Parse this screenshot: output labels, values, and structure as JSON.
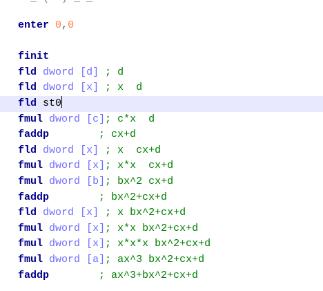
{
  "editor": {
    "top_partial": "  _ (  ) _ _ ",
    "lines": [
      {
        "parts": [
          {
            "t": "kw",
            "v": "enter"
          },
          {
            "t": "sp",
            "v": " "
          },
          {
            "t": "num",
            "v": "0"
          },
          {
            "t": "punct",
            "v": ","
          },
          {
            "t": "num",
            "v": "0"
          }
        ]
      },
      {
        "parts": []
      },
      {
        "parts": [
          {
            "t": "kw",
            "v": "finit"
          }
        ]
      },
      {
        "parts": [
          {
            "t": "kw",
            "v": "fld"
          },
          {
            "t": "sp",
            "v": " "
          },
          {
            "t": "size",
            "v": "dword"
          },
          {
            "t": "sp",
            "v": " "
          },
          {
            "t": "bracket",
            "v": "[d]"
          },
          {
            "t": "sp",
            "v": " "
          },
          {
            "t": "cmt",
            "v": "; d"
          }
        ]
      },
      {
        "parts": [
          {
            "t": "kw",
            "v": "fld"
          },
          {
            "t": "sp",
            "v": " "
          },
          {
            "t": "size",
            "v": "dword"
          },
          {
            "t": "sp",
            "v": " "
          },
          {
            "t": "bracket",
            "v": "[x]"
          },
          {
            "t": "sp",
            "v": " "
          },
          {
            "t": "cmt",
            "v": "; x  d"
          }
        ]
      },
      {
        "current": true,
        "caret": true,
        "parts": [
          {
            "t": "kw",
            "v": "fld"
          },
          {
            "t": "sp",
            "v": " "
          },
          {
            "t": "reg",
            "v": "st0"
          }
        ]
      },
      {
        "parts": [
          {
            "t": "kw",
            "v": "fmul"
          },
          {
            "t": "sp",
            "v": " "
          },
          {
            "t": "size",
            "v": "dword"
          },
          {
            "t": "sp",
            "v": " "
          },
          {
            "t": "bracket",
            "v": "[c]"
          },
          {
            "t": "cmt",
            "v": "; c*x  d"
          }
        ]
      },
      {
        "parts": [
          {
            "t": "kw",
            "v": "faddp"
          },
          {
            "t": "sp",
            "v": "        "
          },
          {
            "t": "cmt",
            "v": "; cx+d"
          }
        ]
      },
      {
        "parts": [
          {
            "t": "kw",
            "v": "fld"
          },
          {
            "t": "sp",
            "v": " "
          },
          {
            "t": "size",
            "v": "dword"
          },
          {
            "t": "sp",
            "v": " "
          },
          {
            "t": "bracket",
            "v": "[x]"
          },
          {
            "t": "sp",
            "v": " "
          },
          {
            "t": "cmt",
            "v": "; x  cx+d"
          }
        ]
      },
      {
        "parts": [
          {
            "t": "kw",
            "v": "fmul"
          },
          {
            "t": "sp",
            "v": " "
          },
          {
            "t": "size",
            "v": "dword"
          },
          {
            "t": "sp",
            "v": " "
          },
          {
            "t": "bracket",
            "v": "[x]"
          },
          {
            "t": "cmt",
            "v": "; x*x  cx+d"
          }
        ]
      },
      {
        "parts": [
          {
            "t": "kw",
            "v": "fmul"
          },
          {
            "t": "sp",
            "v": " "
          },
          {
            "t": "size",
            "v": "dword"
          },
          {
            "t": "sp",
            "v": " "
          },
          {
            "t": "bracket",
            "v": "[b]"
          },
          {
            "t": "cmt",
            "v": "; bx^2 cx+d"
          }
        ]
      },
      {
        "parts": [
          {
            "t": "kw",
            "v": "faddp"
          },
          {
            "t": "sp",
            "v": "        "
          },
          {
            "t": "cmt",
            "v": "; bx^2+cx+d"
          }
        ]
      },
      {
        "parts": [
          {
            "t": "kw",
            "v": "fld"
          },
          {
            "t": "sp",
            "v": " "
          },
          {
            "t": "size",
            "v": "dword"
          },
          {
            "t": "sp",
            "v": " "
          },
          {
            "t": "bracket",
            "v": "[x]"
          },
          {
            "t": "sp",
            "v": " "
          },
          {
            "t": "cmt",
            "v": "; x bx^2+cx+d"
          }
        ]
      },
      {
        "parts": [
          {
            "t": "kw",
            "v": "fmul"
          },
          {
            "t": "sp",
            "v": " "
          },
          {
            "t": "size",
            "v": "dword"
          },
          {
            "t": "sp",
            "v": " "
          },
          {
            "t": "bracket",
            "v": "[x]"
          },
          {
            "t": "cmt",
            "v": "; x*x bx^2+cx+d"
          }
        ]
      },
      {
        "parts": [
          {
            "t": "kw",
            "v": "fmul"
          },
          {
            "t": "sp",
            "v": " "
          },
          {
            "t": "size",
            "v": "dword"
          },
          {
            "t": "sp",
            "v": " "
          },
          {
            "t": "bracket",
            "v": "[x]"
          },
          {
            "t": "cmt",
            "v": "; x*x*x bx^2+cx+d"
          }
        ]
      },
      {
        "parts": [
          {
            "t": "kw",
            "v": "fmul"
          },
          {
            "t": "sp",
            "v": " "
          },
          {
            "t": "size",
            "v": "dword"
          },
          {
            "t": "sp",
            "v": " "
          },
          {
            "t": "bracket",
            "v": "[a]"
          },
          {
            "t": "cmt",
            "v": "; ax^3 bx^2+cx+d"
          }
        ]
      },
      {
        "parts": [
          {
            "t": "kw",
            "v": "faddp"
          },
          {
            "t": "sp",
            "v": "        "
          },
          {
            "t": "cmt",
            "v": "; ax^3+bx^2+cx+d"
          }
        ]
      }
    ]
  },
  "colors": {
    "keyword": "#00008a",
    "operand_size": "#6f6fff",
    "number": "#ff8040",
    "comment": "#008000",
    "current_line": "#e8e8ff"
  }
}
